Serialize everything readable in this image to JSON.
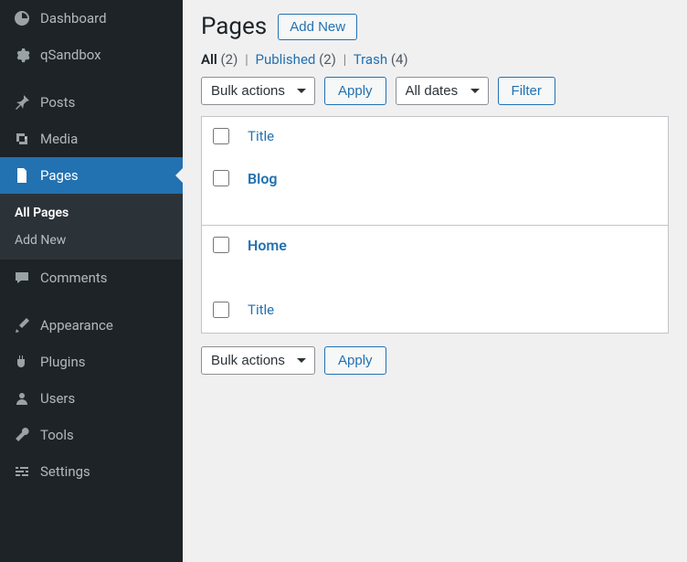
{
  "sidebar": {
    "items": [
      {
        "label": "Dashboard"
      },
      {
        "label": "qSandbox"
      },
      {
        "label": "Posts"
      },
      {
        "label": "Media"
      },
      {
        "label": "Pages"
      },
      {
        "label": "Comments"
      },
      {
        "label": "Appearance"
      },
      {
        "label": "Plugins"
      },
      {
        "label": "Users"
      },
      {
        "label": "Tools"
      },
      {
        "label": "Settings"
      }
    ],
    "submenu": {
      "all_pages": "All Pages",
      "add_new": "Add New"
    }
  },
  "header": {
    "title": "Pages",
    "add_new": "Add New"
  },
  "filters": {
    "all_label": "All",
    "all_count": "(2)",
    "published_label": "Published",
    "published_count": "(2)",
    "trash_label": "Trash",
    "trash_count": "(4)"
  },
  "controls": {
    "bulk_actions": "Bulk actions",
    "apply": "Apply",
    "all_dates": "All dates",
    "filter": "Filter"
  },
  "table": {
    "col_title": "Title",
    "rows": [
      {
        "title": "Blog"
      },
      {
        "title": "Home"
      }
    ]
  }
}
